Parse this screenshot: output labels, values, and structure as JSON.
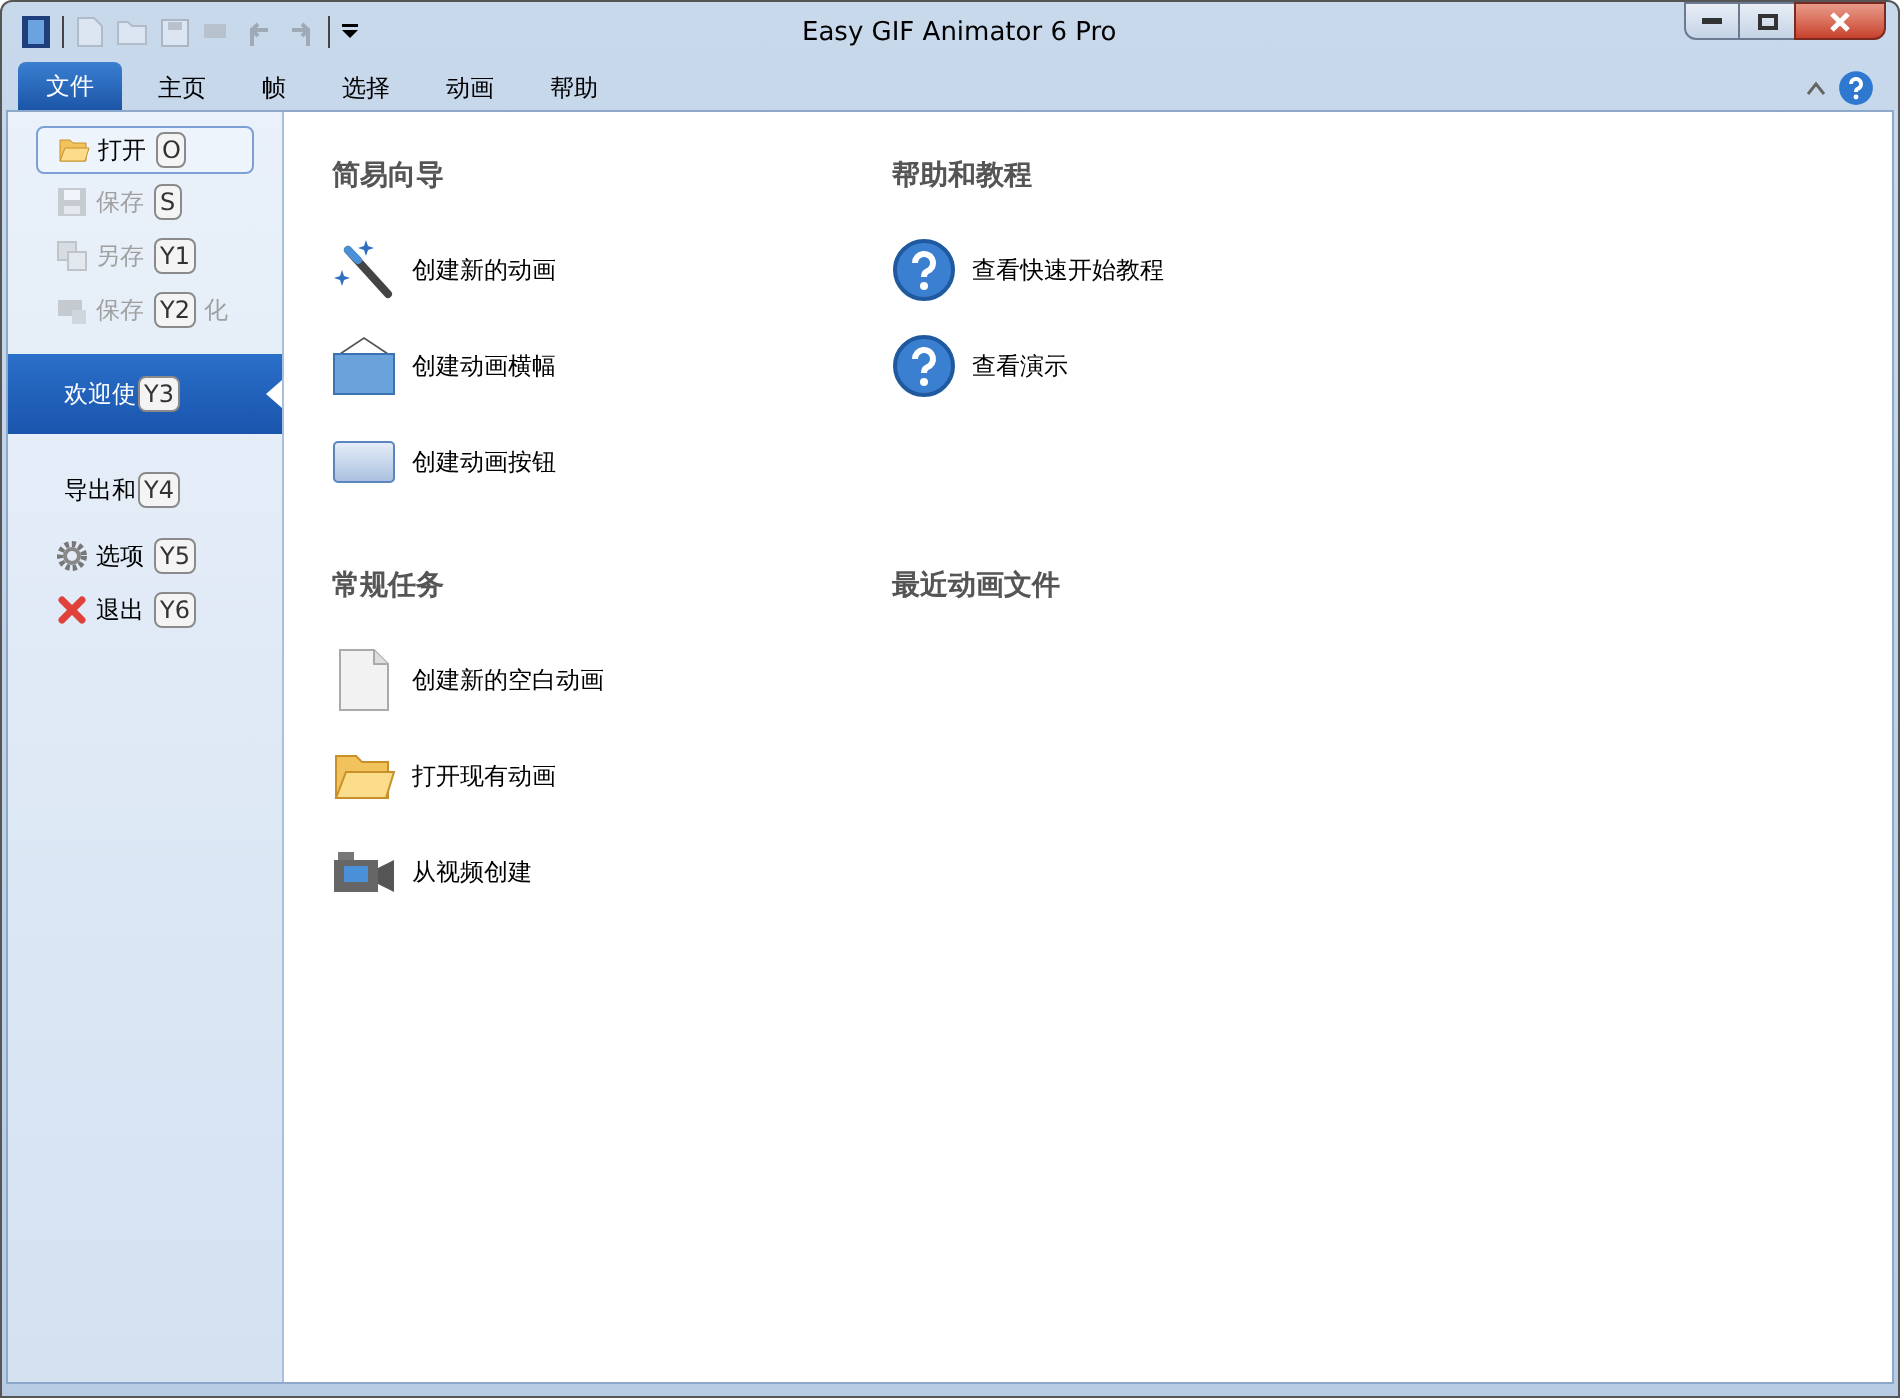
{
  "window": {
    "title": "Easy GIF Animator 6 Pro"
  },
  "ribbon_tabs": [
    {
      "label": "文件",
      "selected": true
    },
    {
      "label": "主页",
      "selected": false
    },
    {
      "label": "帧",
      "selected": false
    },
    {
      "label": "选择",
      "selected": false
    },
    {
      "label": "动画",
      "selected": false
    },
    {
      "label": "帮助",
      "selected": false
    }
  ],
  "sidebar": {
    "items": [
      {
        "kind": "command",
        "label": "打开",
        "key": "O",
        "disabled": false,
        "selected": false,
        "focused": true
      },
      {
        "kind": "command",
        "label": "保存",
        "key": "S",
        "disabled": true,
        "selected": false,
        "focused": false
      },
      {
        "kind": "command",
        "label": "另存",
        "key": "Y1",
        "disabled": true,
        "selected": false,
        "focused": false
      },
      {
        "kind": "command",
        "label": "保存",
        "key": "Y2",
        "tail": "化",
        "disabled": true,
        "selected": false,
        "focused": false
      },
      {
        "kind": "page",
        "label": "欢迎使",
        "key": "Y3",
        "disabled": false,
        "selected": true,
        "focused": false
      },
      {
        "kind": "page",
        "label": "导出和",
        "key": "Y4",
        "disabled": false,
        "selected": false,
        "focused": false
      },
      {
        "kind": "command",
        "label": "选项",
        "key": "Y5",
        "disabled": false,
        "selected": false,
        "focused": false
      },
      {
        "kind": "command",
        "label": "退出",
        "key": "Y6",
        "disabled": false,
        "selected": false,
        "focused": false
      }
    ]
  },
  "sections": [
    {
      "title": "简易向导",
      "items": [
        {
          "label": "创建新的动画"
        },
        {
          "label": "创建动画横幅"
        },
        {
          "label": "创建动画按钮"
        }
      ]
    },
    {
      "title": "帮助和教程",
      "items": [
        {
          "label": "查看快速开始教程"
        },
        {
          "label": "查看演示"
        }
      ]
    },
    {
      "title": "常规任务",
      "items": [
        {
          "label": "创建新的空白动画"
        },
        {
          "label": "打开现有动画"
        },
        {
          "label": "从视频创建"
        }
      ]
    },
    {
      "title": "最近动画文件"
    }
  ]
}
